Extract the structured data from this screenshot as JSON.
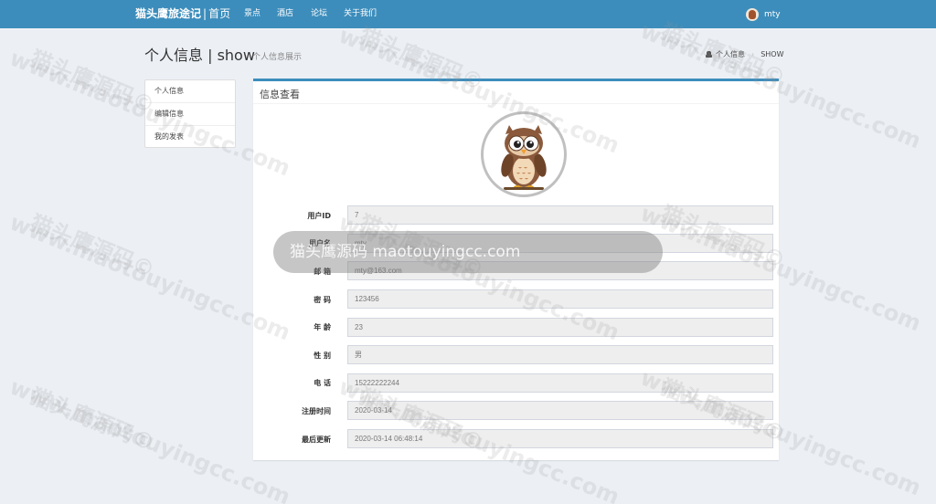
{
  "navbar": {
    "brand": "猫头鹰旅途记",
    "separator": "|",
    "brand_home": "首页",
    "items": [
      "景点",
      "酒店",
      "论坛",
      "关于我们"
    ],
    "username": "mty",
    "color": "#3c8dbc"
  },
  "header": {
    "title": "个人信息 | show",
    "subtitle": "个人信息展示",
    "breadcrumb": [
      "个人信息",
      "SHOW"
    ]
  },
  "side_menu": [
    "个人信息",
    "编辑信息",
    "我的发表"
  ],
  "panel": {
    "title": "信息查看",
    "avatar_icon": "owl-avatar",
    "fields": [
      {
        "label": "用户ID",
        "value": "7"
      },
      {
        "label": "用户名",
        "value": "mty"
      },
      {
        "label": "邮    箱",
        "value": "mty@163.com"
      },
      {
        "label": "密    码",
        "value": "123456"
      },
      {
        "label": "年    龄",
        "value": "23"
      },
      {
        "label": "性    别",
        "value": "男"
      },
      {
        "label": "电    话",
        "value": "15222222244"
      },
      {
        "label": "注册时间",
        "value": "2020-03-14"
      },
      {
        "label": "最后更新",
        "value": "2020-03-14 06:48:14"
      }
    ]
  },
  "watermark": {
    "text_cn": "猫头鹰源码©",
    "text_url": "www.maotouyingcc.com",
    "pill_text": "猫头鹰源码 maotouyingcc.com"
  }
}
